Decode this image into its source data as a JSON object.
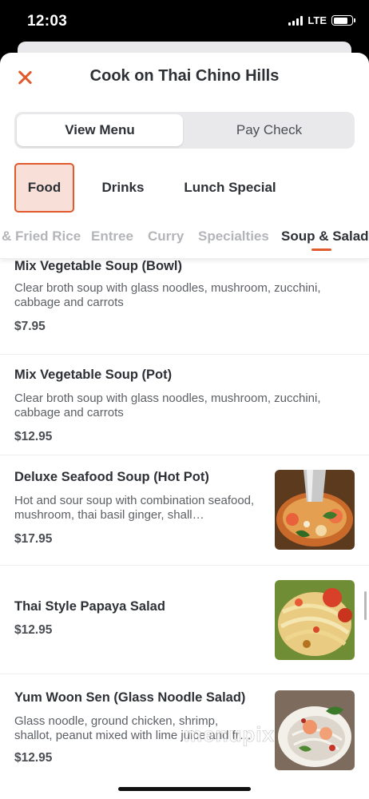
{
  "status_bar": {
    "time": "12:03",
    "network": "LTE",
    "icons": [
      "signal-icon",
      "battery-icon"
    ]
  },
  "header": {
    "title": "Cook on Thai Chino Hills",
    "close_icon": "close-icon"
  },
  "mode_toggle": {
    "options": [
      "View Menu",
      "Pay Check"
    ],
    "selected": "View Menu"
  },
  "categories": {
    "items": [
      "Food",
      "Drinks",
      "Lunch Special"
    ],
    "selected": "Food"
  },
  "subcategories": {
    "items": [
      "& Fried Rice",
      "Entree",
      "Curry",
      "Specialties",
      "Soup & Salad"
    ],
    "selected": "Soup & Salad"
  },
  "menu_items": [
    {
      "name": "Mix Vegetable Soup (Bowl)",
      "description": "Clear broth soup with glass noodles, mushroom, zucchini, cabbage and carrots",
      "price": "$7.95"
    },
    {
      "name": "Mix Vegetable Soup (Pot)",
      "description": "Clear broth soup with glass noodles, mushroom, zucchini, cabbage and carrots",
      "price": "$12.95"
    },
    {
      "name": "Deluxe Seafood Soup (Hot Pot)",
      "description": "Hot and sour soup with combination seafood, mushroom, thai basil ginger, shall…",
      "price": "$17.95"
    },
    {
      "name": "Thai Style Papaya Salad",
      "description": "",
      "price": "$12.95"
    },
    {
      "name": "Yum Woon Sen (Glass Noodle Salad)",
      "description": "Glass noodle, ground chicken, shrimp, shallot, peanut mixed with lime juice and fr…",
      "price": "$12.95"
    }
  ],
  "watermark": "menupix",
  "colors": {
    "accent": "#e05a2b",
    "selected_category_bg": "#f8dfd8",
    "text_primary": "#2d3035",
    "text_secondary": "#5c5f64",
    "inactive_tab": "#b3b5b9"
  }
}
